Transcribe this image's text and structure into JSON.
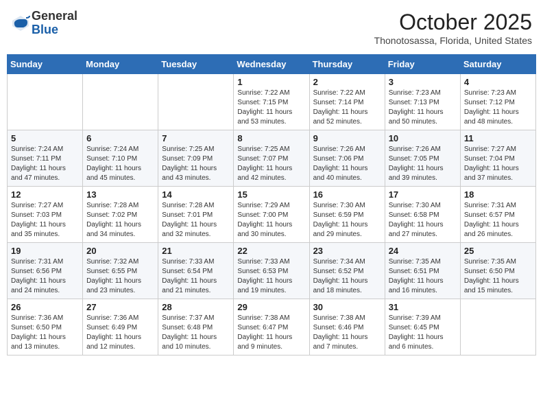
{
  "header": {
    "logo_general": "General",
    "logo_blue": "Blue",
    "month_title": "October 2025",
    "location": "Thonotosassa, Florida, United States"
  },
  "days_of_week": [
    "Sunday",
    "Monday",
    "Tuesday",
    "Wednesday",
    "Thursday",
    "Friday",
    "Saturday"
  ],
  "weeks": [
    [
      {
        "day": "",
        "info": ""
      },
      {
        "day": "",
        "info": ""
      },
      {
        "day": "",
        "info": ""
      },
      {
        "day": "1",
        "info": "Sunrise: 7:22 AM\nSunset: 7:15 PM\nDaylight: 11 hours and 53 minutes."
      },
      {
        "day": "2",
        "info": "Sunrise: 7:22 AM\nSunset: 7:14 PM\nDaylight: 11 hours and 52 minutes."
      },
      {
        "day": "3",
        "info": "Sunrise: 7:23 AM\nSunset: 7:13 PM\nDaylight: 11 hours and 50 minutes."
      },
      {
        "day": "4",
        "info": "Sunrise: 7:23 AM\nSunset: 7:12 PM\nDaylight: 11 hours and 48 minutes."
      }
    ],
    [
      {
        "day": "5",
        "info": "Sunrise: 7:24 AM\nSunset: 7:11 PM\nDaylight: 11 hours and 47 minutes."
      },
      {
        "day": "6",
        "info": "Sunrise: 7:24 AM\nSunset: 7:10 PM\nDaylight: 11 hours and 45 minutes."
      },
      {
        "day": "7",
        "info": "Sunrise: 7:25 AM\nSunset: 7:09 PM\nDaylight: 11 hours and 43 minutes."
      },
      {
        "day": "8",
        "info": "Sunrise: 7:25 AM\nSunset: 7:07 PM\nDaylight: 11 hours and 42 minutes."
      },
      {
        "day": "9",
        "info": "Sunrise: 7:26 AM\nSunset: 7:06 PM\nDaylight: 11 hours and 40 minutes."
      },
      {
        "day": "10",
        "info": "Sunrise: 7:26 AM\nSunset: 7:05 PM\nDaylight: 11 hours and 39 minutes."
      },
      {
        "day": "11",
        "info": "Sunrise: 7:27 AM\nSunset: 7:04 PM\nDaylight: 11 hours and 37 minutes."
      }
    ],
    [
      {
        "day": "12",
        "info": "Sunrise: 7:27 AM\nSunset: 7:03 PM\nDaylight: 11 hours and 35 minutes."
      },
      {
        "day": "13",
        "info": "Sunrise: 7:28 AM\nSunset: 7:02 PM\nDaylight: 11 hours and 34 minutes."
      },
      {
        "day": "14",
        "info": "Sunrise: 7:28 AM\nSunset: 7:01 PM\nDaylight: 11 hours and 32 minutes."
      },
      {
        "day": "15",
        "info": "Sunrise: 7:29 AM\nSunset: 7:00 PM\nDaylight: 11 hours and 30 minutes."
      },
      {
        "day": "16",
        "info": "Sunrise: 7:30 AM\nSunset: 6:59 PM\nDaylight: 11 hours and 29 minutes."
      },
      {
        "day": "17",
        "info": "Sunrise: 7:30 AM\nSunset: 6:58 PM\nDaylight: 11 hours and 27 minutes."
      },
      {
        "day": "18",
        "info": "Sunrise: 7:31 AM\nSunset: 6:57 PM\nDaylight: 11 hours and 26 minutes."
      }
    ],
    [
      {
        "day": "19",
        "info": "Sunrise: 7:31 AM\nSunset: 6:56 PM\nDaylight: 11 hours and 24 minutes."
      },
      {
        "day": "20",
        "info": "Sunrise: 7:32 AM\nSunset: 6:55 PM\nDaylight: 11 hours and 23 minutes."
      },
      {
        "day": "21",
        "info": "Sunrise: 7:33 AM\nSunset: 6:54 PM\nDaylight: 11 hours and 21 minutes."
      },
      {
        "day": "22",
        "info": "Sunrise: 7:33 AM\nSunset: 6:53 PM\nDaylight: 11 hours and 19 minutes."
      },
      {
        "day": "23",
        "info": "Sunrise: 7:34 AM\nSunset: 6:52 PM\nDaylight: 11 hours and 18 minutes."
      },
      {
        "day": "24",
        "info": "Sunrise: 7:35 AM\nSunset: 6:51 PM\nDaylight: 11 hours and 16 minutes."
      },
      {
        "day": "25",
        "info": "Sunrise: 7:35 AM\nSunset: 6:50 PM\nDaylight: 11 hours and 15 minutes."
      }
    ],
    [
      {
        "day": "26",
        "info": "Sunrise: 7:36 AM\nSunset: 6:50 PM\nDaylight: 11 hours and 13 minutes."
      },
      {
        "day": "27",
        "info": "Sunrise: 7:36 AM\nSunset: 6:49 PM\nDaylight: 11 hours and 12 minutes."
      },
      {
        "day": "28",
        "info": "Sunrise: 7:37 AM\nSunset: 6:48 PM\nDaylight: 11 hours and 10 minutes."
      },
      {
        "day": "29",
        "info": "Sunrise: 7:38 AM\nSunset: 6:47 PM\nDaylight: 11 hours and 9 minutes."
      },
      {
        "day": "30",
        "info": "Sunrise: 7:38 AM\nSunset: 6:46 PM\nDaylight: 11 hours and 7 minutes."
      },
      {
        "day": "31",
        "info": "Sunrise: 7:39 AM\nSunset: 6:45 PM\nDaylight: 11 hours and 6 minutes."
      },
      {
        "day": "",
        "info": ""
      }
    ]
  ]
}
